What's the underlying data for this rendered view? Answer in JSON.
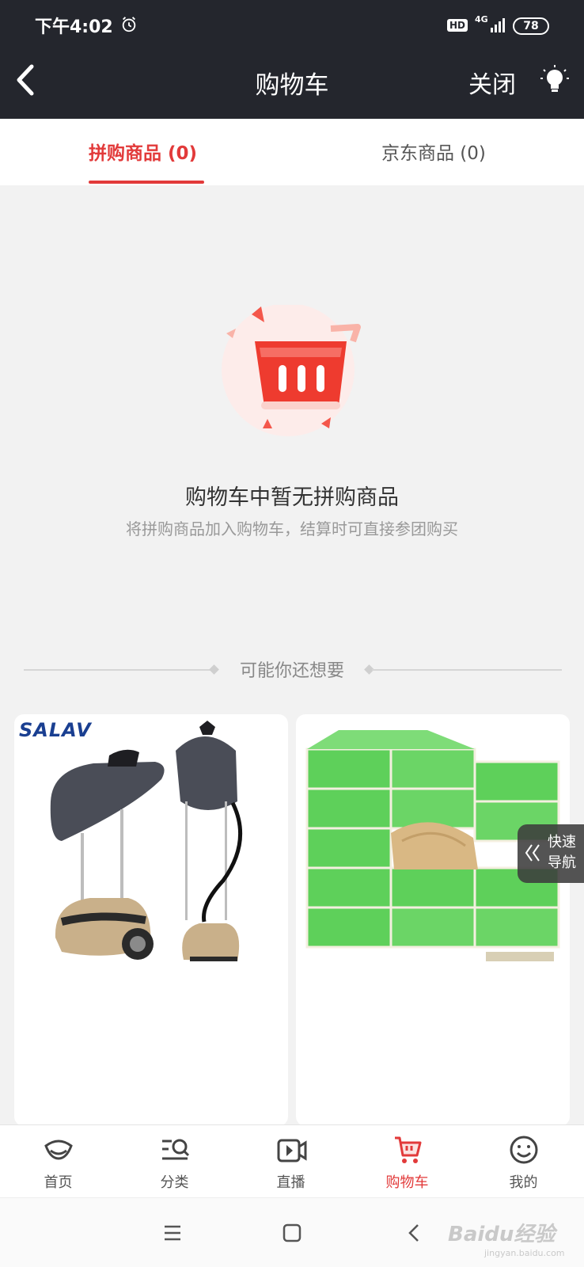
{
  "status_bar": {
    "time": "下午4:02",
    "hd": "HD",
    "network": "4G",
    "battery": "78"
  },
  "header": {
    "title": "购物车",
    "close_label": "关闭"
  },
  "tabs": [
    {
      "label": "拼购商品 (0)",
      "active": true
    },
    {
      "label": "京东商品 (0)",
      "active": false
    }
  ],
  "empty_state": {
    "title": "购物车中暂无拼购商品",
    "subtitle": "将拼购商品加入购物车，结算时可直接参团购买"
  },
  "recommend": {
    "title": "可能你还想要"
  },
  "products": [
    {
      "brand": "SALAV",
      "icon": "garment-steamer-image"
    },
    {
      "icon": "tissue-pack-image"
    }
  ],
  "quick_nav": {
    "label": "快速导航"
  },
  "tab_bar": [
    {
      "label": "首页",
      "icon": "home-icon",
      "active": false
    },
    {
      "label": "分类",
      "icon": "category-icon",
      "active": false
    },
    {
      "label": "直播",
      "icon": "live-icon",
      "active": false
    },
    {
      "label": "购物车",
      "icon": "cart-icon",
      "active": true
    },
    {
      "label": "我的",
      "icon": "profile-icon",
      "active": false
    }
  ],
  "watermark": {
    "text": "Baidu经验",
    "sub": "jingyan.baidu.com"
  },
  "colors": {
    "accent": "#e23a3a",
    "header_bg": "#24262d",
    "page_bg": "#f2f2f2"
  }
}
